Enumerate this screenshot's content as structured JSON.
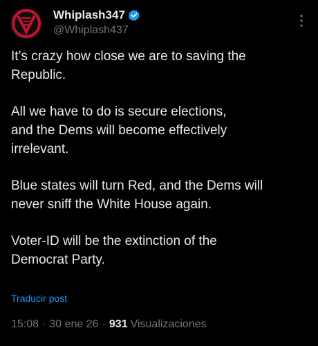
{
  "colors": {
    "background": "#000000",
    "text_primary": "#e7e9ea",
    "text_secondary": "#71767b",
    "link": "#1d9bf0",
    "verified_badge": "#1d9bf0",
    "avatar_accent": "#c8102e"
  },
  "author": {
    "display_name": "Whiplash347",
    "handle": "@Whiplash437",
    "verified": true,
    "avatar_icon": "red-circle-v-logo"
  },
  "menu_icon": "more-vertical-icon",
  "tweet": {
    "paragraphs": [
      "It’s crazy how close we are to saving the\nRepublic.",
      "All we have to do is secure elections,\nand the Dems will become effectively\nirrelevant.",
      "Blue states will turn Red, and the Dems will\nnever sniff the White House again.",
      "Voter-ID will be the extinction of the\nDemocrat Party."
    ],
    "translate_label": "Traducir post"
  },
  "meta": {
    "time": "15:08",
    "separator": "·",
    "date": "30 ene 26",
    "views_count": "931",
    "views_label": "Visualizaciones"
  }
}
